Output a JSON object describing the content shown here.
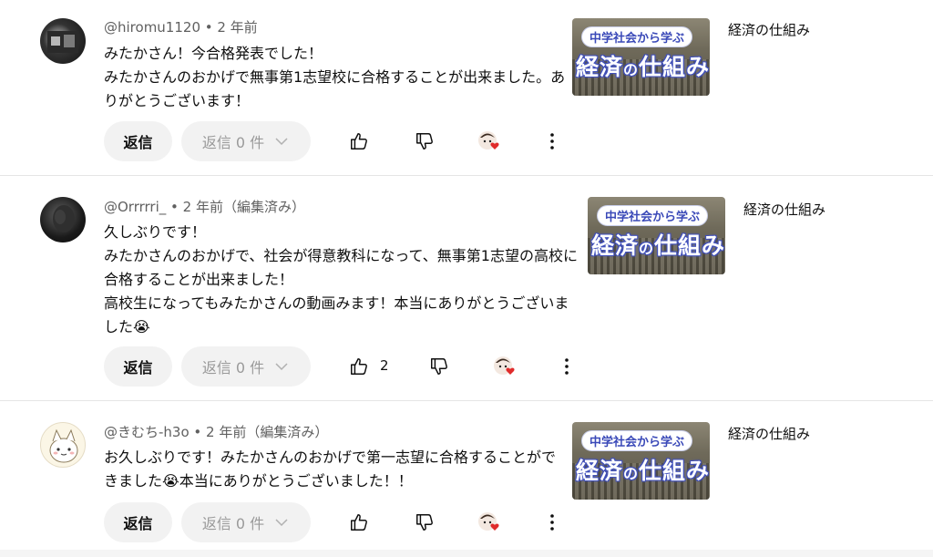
{
  "comments": [
    {
      "author": "@hiromu1120",
      "time": " • 2 年前",
      "text": "みたかさん！今合格発表でした！\nみたかさんのおかげで無事第1志望校に合格することが出来ました。あ\nりがとうございます！",
      "reply_label": "返信",
      "replies_label": "返信 0 件",
      "likes": "",
      "thumb_tag": "中学社会から学ぶ",
      "thumb_title_a": "経済",
      "thumb_title_b": "の",
      "thumb_title_c": "仕組み",
      "channel": "経済の仕組み"
    },
    {
      "author": "@Orrrrri_",
      "time": " • 2 年前（編集済み）",
      "text": "久しぶりです！\nみたかさんのおかげで、社会が得意教科になって、無事第1志望の高校に\n合格することが出来ました！\n高校生になってもみたかさんの動画みます！本当にありがとうございま\nした😭",
      "reply_label": "返信",
      "replies_label": "返信 0 件",
      "likes": "2",
      "thumb_tag": "中学社会から学ぶ",
      "thumb_title_a": "経済",
      "thumb_title_b": "の",
      "thumb_title_c": "仕組み",
      "channel": "経済の仕組み"
    },
    {
      "author": "@きむち-h3o",
      "time": " • 2 年前（編集済み）",
      "text": "お久しぶりです！みたかさんのおかげで第一志望に合格することがで\nきました😭本当にありがとうございました！！",
      "reply_label": "返信",
      "replies_label": "返信 0 件",
      "likes": "",
      "thumb_tag": "中学社会から学ぶ",
      "thumb_title_a": "経済",
      "thumb_title_b": "の",
      "thumb_title_c": "仕組み",
      "channel": "経済の仕組み"
    }
  ],
  "icons": {
    "like": "thumbs-up-icon",
    "dislike": "thumbs-down-icon",
    "creator_heart": "creator-heart-icon",
    "more": "more-vert-icon",
    "expand": "chevron-down-icon"
  },
  "colors": {
    "heart": "#e02b2b",
    "button_bg": "#f2f2f2",
    "meta_text": "#606060"
  }
}
